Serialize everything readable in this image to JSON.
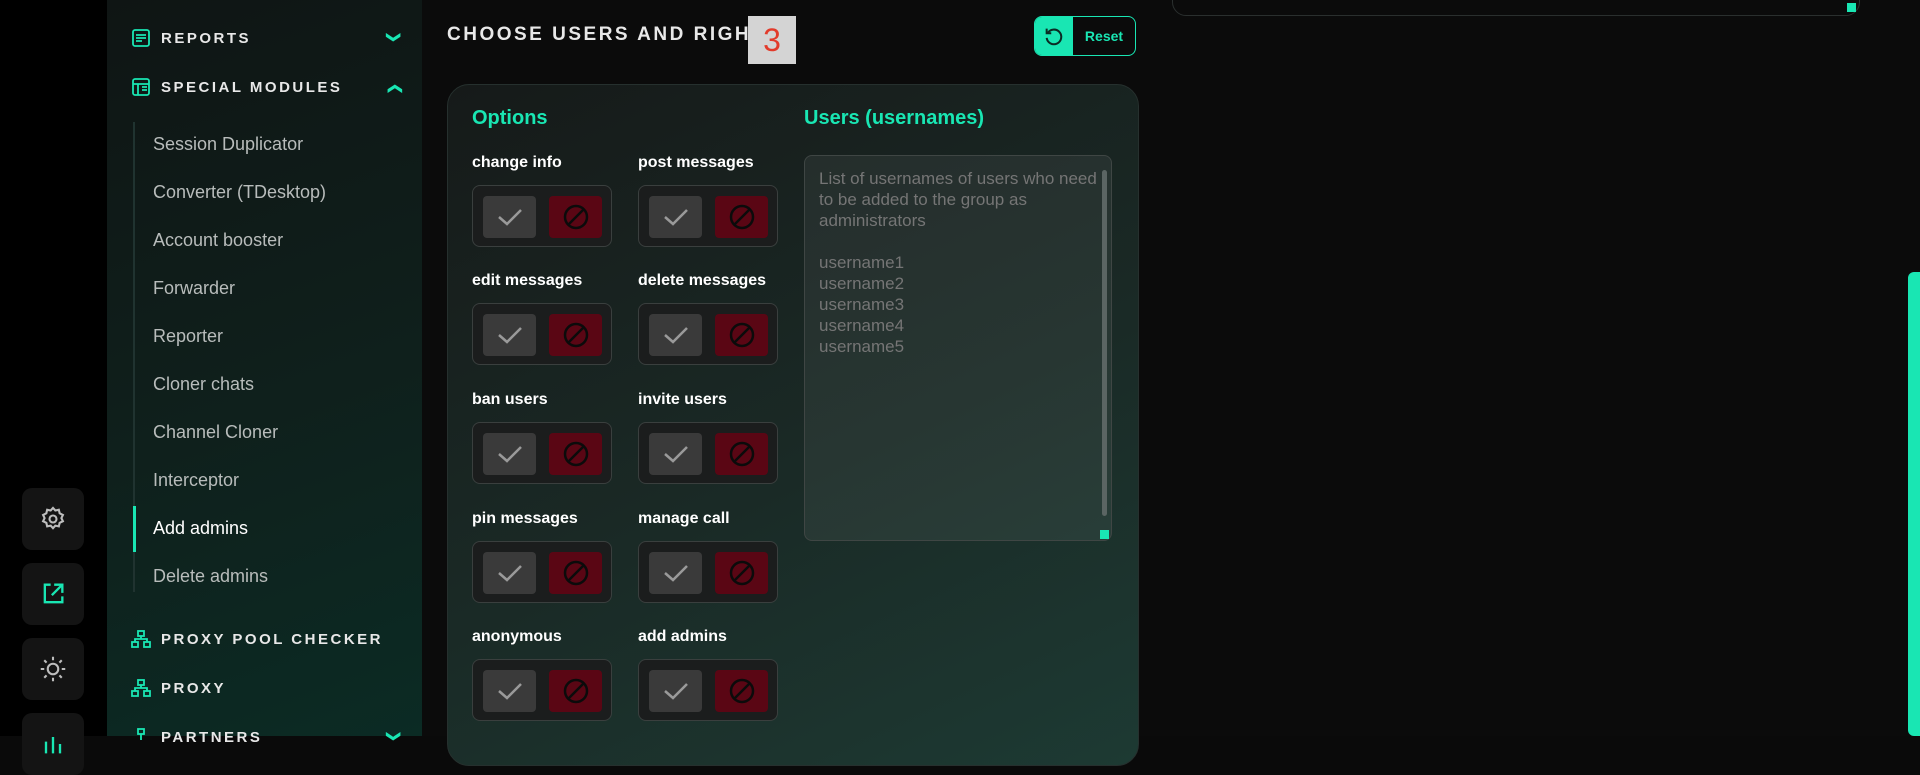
{
  "sidebar": {
    "sections": [
      {
        "label": "REPORTS",
        "expanded": false
      },
      {
        "label": "SPECIAL MODULES",
        "expanded": true
      },
      {
        "label": "PROXY POOL CHECKER"
      },
      {
        "label": "PROXY"
      },
      {
        "label": "PARTNERS",
        "expanded": false
      }
    ],
    "items": [
      "Session Duplicator",
      "Converter (TDesktop)",
      "Account booster",
      "Forwarder",
      "Reporter",
      "Cloner chats",
      "Channel Cloner",
      "Interceptor",
      "Add admins",
      "Delete admins"
    ],
    "active_item": "Add admins"
  },
  "header": {
    "title": "CHOOSE USERS AND RIGHTS",
    "step": "3",
    "reset_label": "Reset"
  },
  "panel": {
    "options_title": "Options",
    "users_title": "Users (usernames)",
    "options": [
      {
        "label": "change info"
      },
      {
        "label": "post messages"
      },
      {
        "label": "edit messages"
      },
      {
        "label": "delete messages"
      },
      {
        "label": "ban users"
      },
      {
        "label": "invite users"
      },
      {
        "label": "pin messages"
      },
      {
        "label": "manage call"
      },
      {
        "label": "anonymous"
      },
      {
        "label": "add admins"
      }
    ],
    "users_placeholder": "List of usernames of users who need to be added to the group as administrators\n\nusername1\nusername2\nusername3\nusername4\nusername5"
  },
  "colors": {
    "accent": "#19e6b3",
    "deny": "#5a0614",
    "allow": "#3a3a3a"
  }
}
